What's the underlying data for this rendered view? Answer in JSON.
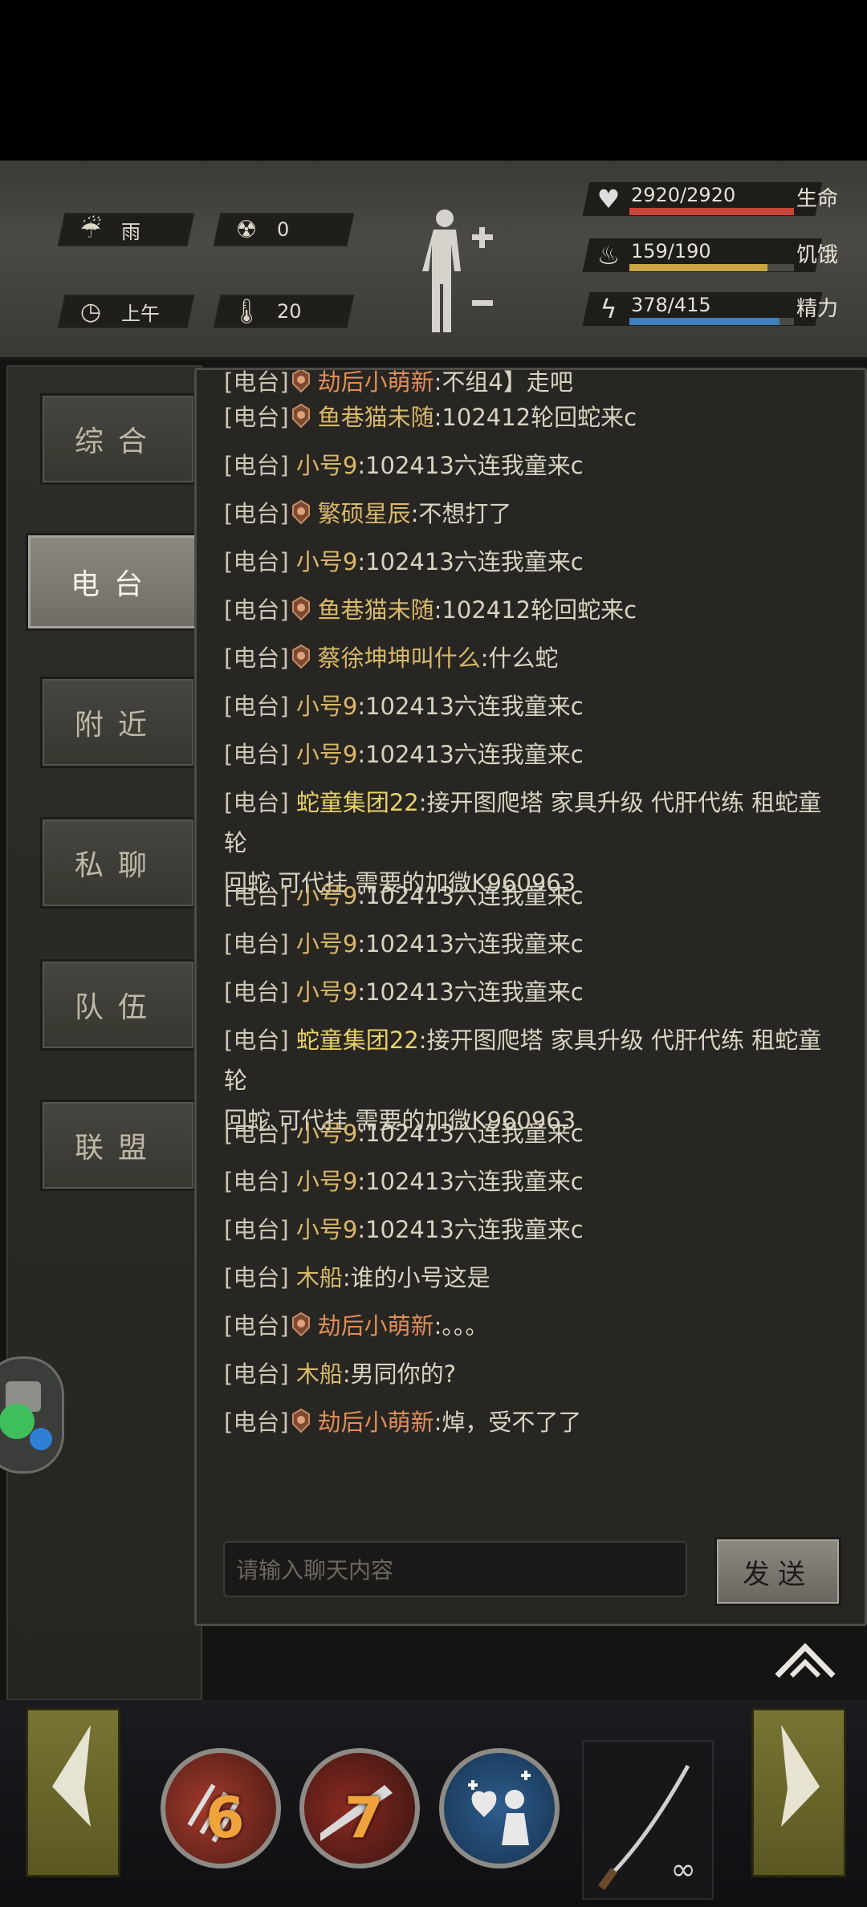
{
  "status": {
    "weather": {
      "icon": "rain-cloud-icon",
      "label": "雨"
    },
    "radiation": {
      "icon": "radiation-icon",
      "value": "0"
    },
    "time_of_day": {
      "icon": "clock-icon",
      "label": "上午"
    },
    "temperature": {
      "icon": "thermometer-icon",
      "value": "20"
    },
    "stats": [
      {
        "name": "生命",
        "value": "2920/2920",
        "fraction": 1.0,
        "color": "#c9453a",
        "icon": "heart-pulse-icon"
      },
      {
        "name": "饥饿",
        "value": "159/190",
        "fraction": 0.84,
        "color": "#c9a441",
        "icon": "stomach-icon"
      },
      {
        "name": "精力",
        "value": "378/415",
        "fraction": 0.91,
        "color": "#3d7fbd",
        "icon": "energy-bolt-icon"
      }
    ]
  },
  "tabs": [
    {
      "label": "综合",
      "active": false
    },
    {
      "label": "电台",
      "active": true
    },
    {
      "label": "附近",
      "active": false
    },
    {
      "label": "私聊",
      "active": false
    },
    {
      "label": "队伍",
      "active": false
    },
    {
      "label": "联盟",
      "active": false
    }
  ],
  "messages": [
    {
      "channel": "[电台]",
      "avatar": true,
      "name": "劫后小萌新",
      "color": "orange",
      "text": ":不组4】走吧"
    },
    {
      "channel": "[电台]",
      "avatar": true,
      "name": "鱼巷猫未随",
      "color": "gold",
      "text": ":102412轮回蛇来c"
    },
    {
      "channel": "[电台]",
      "avatar": false,
      "name": "小号9",
      "color": "gold",
      "text": ":102413六连我童来c"
    },
    {
      "channel": "[电台]",
      "avatar": true,
      "name": "繁硕星辰",
      "color": "gold",
      "text": ":不想打了"
    },
    {
      "channel": "[电台]",
      "avatar": false,
      "name": "小号9",
      "color": "gold",
      "text": ":102413六连我童来c"
    },
    {
      "channel": "[电台]",
      "avatar": true,
      "name": "鱼巷猫未随",
      "color": "gold",
      "text": ":102412轮回蛇来c"
    },
    {
      "channel": "[电台]",
      "avatar": true,
      "name": "蔡徐坤坤叫什么",
      "color": "gold",
      "text": ":什么蛇"
    },
    {
      "channel": "[电台]",
      "avatar": false,
      "name": "小号9",
      "color": "gold",
      "text": ":102413六连我童来c"
    },
    {
      "channel": "[电台]",
      "avatar": false,
      "name": "小号9",
      "color": "gold",
      "text": ":102413六连我童来c"
    },
    {
      "channel": "[电台]",
      "avatar": false,
      "name": "蛇童集团22",
      "color": "lemon",
      "text": ":接开图爬塔 家具升级 代肝代练 租蛇童 轮",
      "cont": "回蛇 可代挂 需要的加微K960963"
    },
    {
      "channel": "[电台]",
      "avatar": false,
      "name": "小号9",
      "color": "gold",
      "text": ":102413六连我童来c"
    },
    {
      "channel": "[电台]",
      "avatar": false,
      "name": "小号9",
      "color": "gold",
      "text": ":102413六连我童来c"
    },
    {
      "channel": "[电台]",
      "avatar": false,
      "name": "小号9",
      "color": "gold",
      "text": ":102413六连我童来c"
    },
    {
      "channel": "[电台]",
      "avatar": false,
      "name": "蛇童集团22",
      "color": "lemon",
      "text": ":接开图爬塔 家具升级 代肝代练 租蛇童 轮",
      "cont": "回蛇 可代挂 需要的加微K960963"
    },
    {
      "channel": "[电台]",
      "avatar": false,
      "name": "小号9",
      "color": "gold",
      "text": ":102413六连我童来c"
    },
    {
      "channel": "[电台]",
      "avatar": false,
      "name": "小号9",
      "color": "gold",
      "text": ":102413六连我童来c"
    },
    {
      "channel": "[电台]",
      "avatar": false,
      "name": "小号9",
      "color": "gold",
      "text": ":102413六连我童来c"
    },
    {
      "channel": "[电台]",
      "avatar": false,
      "name": "木船",
      "color": "gold",
      "text": ":谁的小号这是"
    },
    {
      "channel": "[电台]",
      "avatar": true,
      "name": "劫后小萌新",
      "color": "orange",
      "text": ":。。。"
    },
    {
      "channel": "[电台]",
      "avatar": false,
      "name": "木船",
      "color": "gold",
      "text": ":男同你的?"
    },
    {
      "channel": "[电台]",
      "avatar": true,
      "name": "劫后小萌新",
      "color": "orange",
      "text": ":焯，受不了了"
    }
  ],
  "input": {
    "placeholder": "请输入聊天内容"
  },
  "send_label": "发送",
  "skills": [
    {
      "number": "6",
      "icon": "claw-skill-icon"
    },
    {
      "number": "7",
      "icon": "blade-skill-icon"
    },
    {
      "number": "",
      "icon": "heal-skill-icon"
    }
  ],
  "weapon": {
    "icon": "katana-icon",
    "ammo": "∞"
  }
}
